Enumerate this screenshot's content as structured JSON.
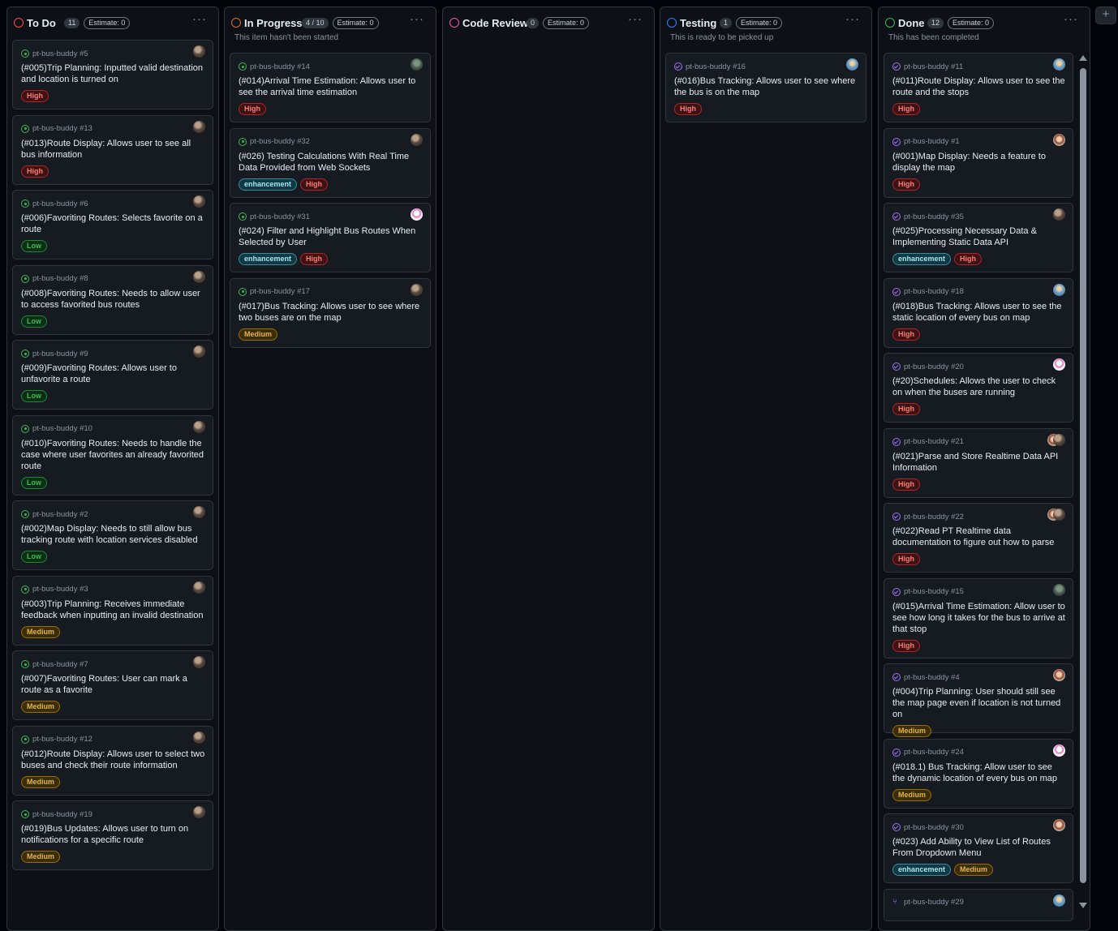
{
  "columns": [
    {
      "key": "todo",
      "title": "To Do",
      "count": "11",
      "estimate": "Estimate: 0",
      "description": "",
      "ring_color": "#f85149",
      "cards": [
        {
          "repo": "pt-bus-buddy #5",
          "title": "(#005)Trip Planning: Inputted valid destination and location is turned on",
          "labels": [
            "High"
          ],
          "icon": "open",
          "avatar": "a"
        },
        {
          "repo": "pt-bus-buddy #13",
          "title": "(#013)Route Display: Allows user to see all bus information",
          "labels": [
            "High"
          ],
          "icon": "open",
          "avatar": "a"
        },
        {
          "repo": "pt-bus-buddy #6",
          "title": "(#006)Favoriting Routes: Selects favorite on a route",
          "labels": [
            "Low"
          ],
          "icon": "open",
          "avatar": "a"
        },
        {
          "repo": "pt-bus-buddy #8",
          "title": "(#008)Favoriting Routes: Needs to allow user to access favorited bus routes",
          "labels": [
            "Low"
          ],
          "icon": "open",
          "avatar": "a"
        },
        {
          "repo": "pt-bus-buddy #9",
          "title": "(#009)Favoriting Routes: Allows user to unfavorite a route",
          "labels": [
            "Low"
          ],
          "icon": "open",
          "avatar": "a"
        },
        {
          "repo": "pt-bus-buddy #10",
          "title": "(#010)Favoriting Routes: Needs to handle the case where user favorites an already favorited route",
          "labels": [
            "Low"
          ],
          "icon": "open",
          "avatar": "a"
        },
        {
          "repo": "pt-bus-buddy #2",
          "title": "(#002)Map Display: Needs to still allow bus tracking route with location services disabled",
          "labels": [
            "Low"
          ],
          "icon": "open",
          "avatar": "a"
        },
        {
          "repo": "pt-bus-buddy #3",
          "title": "(#003)Trip Planning: Receives immediate feedback when inputting an invalid destination",
          "labels": [
            "Medium"
          ],
          "icon": "open",
          "avatar": "a"
        },
        {
          "repo": "pt-bus-buddy #7",
          "title": "(#007)Favoriting Routes: User can mark a route as a favorite",
          "labels": [
            "Medium"
          ],
          "icon": "open",
          "avatar": "a"
        },
        {
          "repo": "pt-bus-buddy #12",
          "title": "(#012)Route Display: Allows user to select two buses and check their route information",
          "labels": [
            "Medium"
          ],
          "icon": "open",
          "avatar": "a"
        },
        {
          "repo": "pt-bus-buddy #19",
          "title": "(#019)Bus Updates: Allows user to turn on notifications for a specific route",
          "labels": [
            "Medium"
          ],
          "icon": "open",
          "avatar": "a"
        }
      ]
    },
    {
      "key": "inprogress",
      "title": "In Progress",
      "count": "4 / 10",
      "estimate": "Estimate: 0",
      "description": "This item hasn't been started",
      "ring_color": "#db6d28",
      "cards": [
        {
          "repo": "pt-bus-buddy #14",
          "title": "(#014)Arrival Time Estimation: Allows user to see the arrival time estimation",
          "labels": [
            "High"
          ],
          "icon": "open",
          "avatar": "e"
        },
        {
          "repo": "pt-bus-buddy #32",
          "title": "(#026) Testing Calculations With Real Time Data Provided from Web Sockets",
          "labels": [
            "enhancement",
            "High"
          ],
          "icon": "open",
          "avatar": "a"
        },
        {
          "repo": "pt-bus-buddy #31",
          "title": "(#024) Filter and Highlight Bus Routes When Selected by User",
          "labels": [
            "enhancement",
            "High"
          ],
          "icon": "open",
          "avatar": "c"
        },
        {
          "repo": "pt-bus-buddy #17",
          "title": "(#017)Bus Tracking: Allows user to see where two buses are on the map",
          "labels": [
            "Medium"
          ],
          "icon": "open",
          "avatar": "a"
        }
      ]
    },
    {
      "key": "codereview",
      "title": "Code Review",
      "count": "0",
      "estimate": "Estimate: 0",
      "description": "",
      "ring_color": "#db61a2",
      "cards": []
    },
    {
      "key": "testing",
      "title": "Testing",
      "count": "1",
      "estimate": "Estimate: 0",
      "description": "This is ready to be picked up",
      "ring_color": "#2f81f7",
      "cards": [
        {
          "repo": "pt-bus-buddy #16",
          "title": "(#016)Bus Tracking: Allows user to see where the bus is on the map",
          "labels": [
            "High"
          ],
          "icon": "closed",
          "avatar": "b"
        }
      ]
    },
    {
      "key": "done",
      "title": "Done",
      "count": "12",
      "estimate": "Estimate: 0",
      "description": "This has been completed",
      "ring_color": "#3fb950",
      "cards": [
        {
          "repo": "pt-bus-buddy #11",
          "title": "(#011)Route Display: Allows user to see the route and the stops",
          "labels": [
            "High"
          ],
          "icon": "closed",
          "avatar": "b"
        },
        {
          "repo": "pt-bus-buddy #1",
          "title": "(#001)Map Display: Needs a feature to display the map",
          "labels": [
            "High"
          ],
          "icon": "closed",
          "avatar": "d"
        },
        {
          "repo": "pt-bus-buddy #35",
          "title": "(#025)Processing Necessary Data & Implementing Static Data API",
          "labels": [
            "enhancement",
            "High"
          ],
          "icon": "closed",
          "avatar": "a"
        },
        {
          "repo": "pt-bus-buddy #18",
          "title": "(#018)Bus Tracking: Allows user to see the static location of every bus on map",
          "labels": [
            "High"
          ],
          "icon": "closed",
          "avatar": "b"
        },
        {
          "repo": "pt-bus-buddy #20",
          "title": "(#20)Schedules: Allows the user to check on when the buses are running",
          "labels": [
            "High"
          ],
          "icon": "closed",
          "avatar": "c"
        },
        {
          "repo": "pt-bus-buddy #21",
          "title": "(#021)Parse and Store Realtime Data API Information",
          "labels": [
            "High"
          ],
          "icon": "closed",
          "avatar": "pair"
        },
        {
          "repo": "pt-bus-buddy #22",
          "title": "(#022)Read PT Realtime data documentation to figure out how to parse",
          "labels": [
            "High"
          ],
          "icon": "closed",
          "avatar": "pair"
        },
        {
          "repo": "pt-bus-buddy #15",
          "title": "(#015)Arrival Time Estimation: Allow user to see how long it takes for the bus to arrive at that stop",
          "labels": [
            "High"
          ],
          "icon": "closed",
          "avatar": "e"
        },
        {
          "repo": "pt-bus-buddy #4",
          "title": "(#004)Trip Planning: User should still see the map page even if location is not turned on",
          "labels": [
            "Medium"
          ],
          "icon": "closed",
          "avatar": "d"
        },
        {
          "repo": "pt-bus-buddy #24",
          "title": "(#018.1) Bus Tracking: Allow user to see the dynamic location of every bus on map",
          "labels": [
            "Medium"
          ],
          "icon": "closed",
          "avatar": "c"
        },
        {
          "repo": "pt-bus-buddy #30",
          "title": "(#023) Add Ability to View List of Routes From Dropdown Menu",
          "labels": [
            "enhancement",
            "Medium"
          ],
          "icon": "closed",
          "avatar": "d"
        },
        {
          "repo": "pt-bus-buddy #29",
          "title": "",
          "labels": [],
          "icon": "pr",
          "avatar": "b"
        }
      ]
    }
  ],
  "add_column_label": "+",
  "menu_label": "···"
}
